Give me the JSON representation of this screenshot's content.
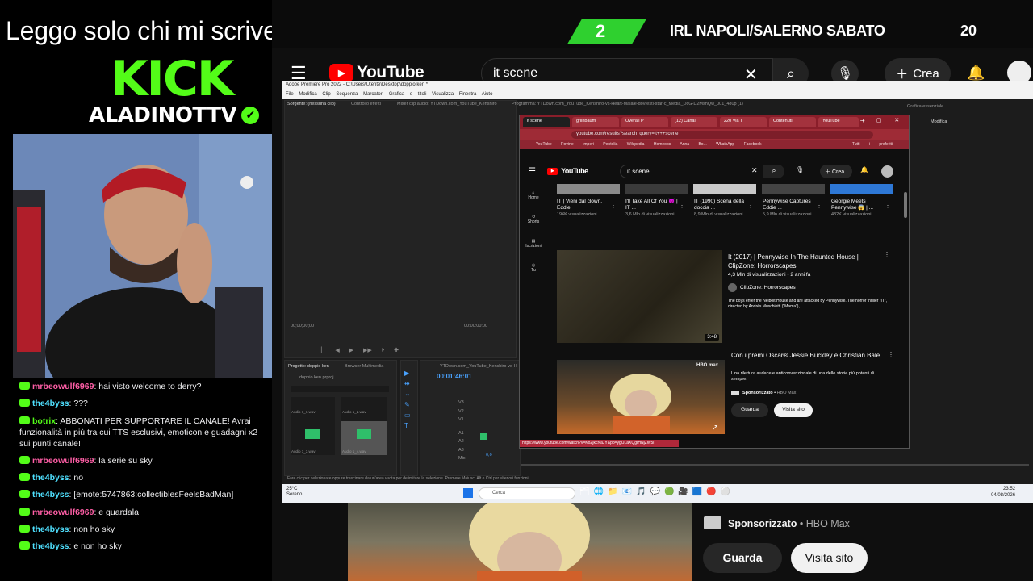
{
  "overlay": {
    "headline": "Leggo solo chi mi scrive su",
    "kick_logo": "KICK",
    "channel": "ALADINOTTV",
    "verified_icon": "verified-check-icon",
    "brand_color": "#53fc18"
  },
  "banner": {
    "score": "2",
    "event_title": "IRL NAPOLI/SALERNO SABATO",
    "event_number": "20"
  },
  "chat": [
    {
      "user": "mrbeowulf6969",
      "color": "#ff5ea6",
      "text": ": hai visto welcome to derry?"
    },
    {
      "user": "the4byss",
      "color": "#4fe0ff",
      "text": ": ???"
    },
    {
      "user": "botrix",
      "color": "#53fc18",
      "text": ": ABBONATI PER SUPPORTARE IL CANALE! Avrai funzionalità in più tra cui TTS esclusivi, emoticon e guadagni x2 sui punti canale!"
    },
    {
      "user": "mrbeowulf6969",
      "color": "#ff5ea6",
      "text": ": la serie su sky"
    },
    {
      "user": "the4byss",
      "color": "#4fe0ff",
      "text": ": no"
    },
    {
      "user": "the4byss",
      "color": "#4fe0ff",
      "text": ": [emote:5747863:collectiblesFeelsBadMan]"
    },
    {
      "user": "mrbeowulf6969",
      "color": "#ff5ea6",
      "text": ": e guardala"
    },
    {
      "user": "the4byss",
      "color": "#4fe0ff",
      "text": ": non ho sky"
    },
    {
      "user": "the4byss",
      "color": "#4fe0ff",
      "text": ": e non ho sky"
    }
  ],
  "youtube_bg": {
    "logo": "YouTube",
    "search_value": "it  scene",
    "create_label": "Crea",
    "sponsored_label": "Sponsorizzato",
    "sponsor_name": "HBO Max",
    "watch_label": "Guarda",
    "visit_label": "Visita sito"
  },
  "premiere": {
    "title": "Adobe Premiere Pro 2022 - C:\\Users\\Utente\\Desktop\\doppio ken *",
    "menu": [
      "File",
      "Modifica",
      "Clip",
      "Sequenza",
      "Marcatori",
      "Grafica e titoli",
      "Visualizza",
      "Finestra",
      "Aiuto"
    ],
    "source_tab": "Sorgente: (nessuna clip)",
    "effects_tab": "Controllo effetti",
    "mixer_tab": "Mixer clip audio: YTDown.com_YouTube_Kenshiro",
    "program_tab": "Programma: YTDown.com_YouTube_Kenshiro-vs-Heart-Malale-dovresti-star-c_Media_DcG-D2MshQw_001_480p (1)",
    "essential_graphics": "Grafica essenziale",
    "edit_tab": "Modifica",
    "source_timecode": "00;00;00;00",
    "program_timecode": "00:00:00:00",
    "project_tab": "Progetto: doppio ken",
    "browser_tab": "Browser Multimedia",
    "project_file": "doppio ken.prproj",
    "audio_clips": [
      "Audio 1_1.wav",
      "Audio 1_2.wav",
      "Audio 1_3.wav",
      "Audio 1_4.wav"
    ],
    "sequence_tab": "YTDown.com_YouTube_Kenshiro-vs-Heart-Malale",
    "sequence_timecode": "00:01:46:01",
    "track_labels": [
      "V3",
      "V2",
      "V1",
      "A1",
      "A2",
      "A3",
      "Mix"
    ],
    "mix_value": "0,0",
    "status_text": "Fare clic per selezionare oppure trascinare da un'area vuota per delimitare la selezione. Premere Maiusc, Alt e Ctrl per ulteriori funzioni."
  },
  "chrome": {
    "tabs": [
      "it scene",
      "griinbaum",
      "Overall P",
      "(12) Canal",
      "220 Via T",
      "Contenuti",
      "YouTube"
    ],
    "url": "youtube.com/results?search_query=it+++scene",
    "bookmarks": [
      "YouTube",
      "Rovine Imperi",
      "Pentolia",
      "Wikipedia",
      "Homeops",
      "Anna Bo...",
      "WhatsApp",
      "Facebook"
    ],
    "other_bookmarks": "Tutti i preferiti",
    "search_value": "it  scene",
    "create_label": "Crea",
    "sidebar": [
      "Home",
      "Shorts",
      "Iscrizioni",
      "Tu"
    ],
    "shorts": [
      {
        "title": "IT | Vieni dal clown, Eddie",
        "views": "196K visualizzazioni"
      },
      {
        "title": "I'll Take All Of You 😈 | IT ...",
        "views": "3,6 Mln di visualizzazioni"
      },
      {
        "title": "IT (1990) Scena della doccia ...",
        "views": "8,9 Mln di visualizzazioni"
      },
      {
        "title": "Pennywise Captures Eddie ...",
        "views": "5,9 Mln di visualizzazioni"
      },
      {
        "title": "Georgie Meets Pennywise 😱 | ...",
        "views": "432K visualizzazioni"
      }
    ],
    "video1": {
      "title": "It (2017) | Pennywise In The Haunted House | ClipZone: Horrorscapes",
      "meta": "4,3 Mln di visualizzazioni • 2 anni fa",
      "channel": "ClipZone: Horrorscapes",
      "description": "The boys enter the Neibolt House and are attacked by Pennywise. The horror thriller \"IT\", directed by Andrés Muschietti (\"Mama\"), ...",
      "duration": "3:48"
    },
    "video2": {
      "title": "Con i premi Oscar® Jessie Buckley e Christian Bale.",
      "description": "Una rilettura audace e anticonvenzionale di una delle storie più potenti di sempre.",
      "sponsored": "Sponsorizzato",
      "channel": "HBO Max",
      "watch": "Guarda",
      "visit": "Visita sito",
      "badge": "HBO max"
    },
    "status_url": "https://www.youtube.com/watch?v=KoZjkcNaJY&pp=ygULaXQgIHNjZW5l"
  },
  "taskbar": {
    "weather_temp": "25°C",
    "weather_text": "Sereno",
    "search_placeholder": "Cerca",
    "time": "23:52",
    "date": "04/08/2026"
  }
}
